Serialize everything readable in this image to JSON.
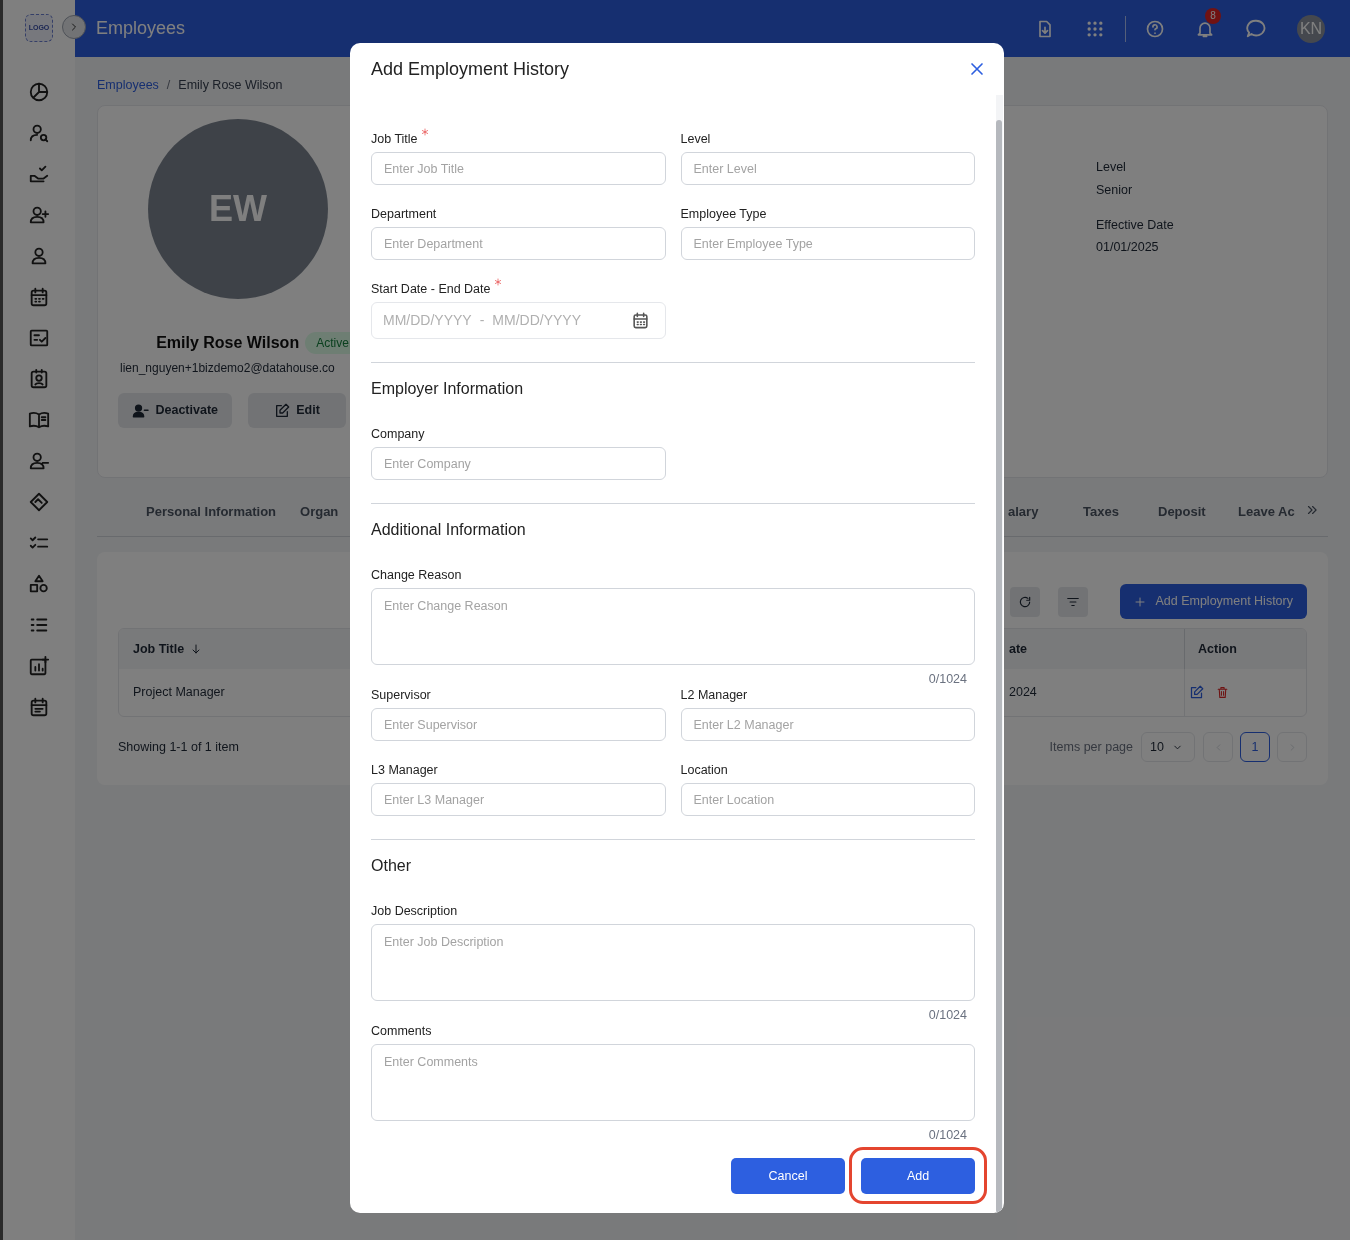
{
  "app_bar": {
    "logo": "LOGO",
    "title": "Employees",
    "notification_count": "8",
    "avatar": "KN"
  },
  "breadcrumb": [
    "Employees",
    "/",
    "Emily Rose Wilson"
  ],
  "profile": {
    "initials": "EW",
    "name": "Emily Rose Wilson",
    "status": "Active",
    "email": "lien_nguyen+1bizdemo2@datahouse.co",
    "buttons": [
      "Deactivate",
      "Edit"
    ],
    "details": [
      {
        "label": "Level",
        "value": "Senior"
      },
      {
        "label": "Effective Date",
        "value": "01/01/2025"
      }
    ]
  },
  "tabs_left": [
    "Personal Information",
    "Organ"
  ],
  "tabs_right": [
    "alary",
    "Taxes",
    "Deposit",
    "Leave Ac"
  ],
  "history": {
    "add_button": "Add Employment History",
    "columns": [
      "Job Title",
      "ate",
      "Action"
    ],
    "rows": [
      [
        "Project Manager",
        "2024"
      ]
    ],
    "showing": "Showing 1-1 of 1 item",
    "per_page_label": "Items per page",
    "page_size": "10",
    "pages": [
      {
        "label": "1",
        "selected": true
      }
    ]
  },
  "dialog": {
    "title": "Add Employment History",
    "sections": [
      {
        "fields": [
          {
            "kind": "input",
            "label": "Job Title",
            "required": true,
            "placeholder": "Enter Job Title"
          },
          {
            "kind": "input",
            "label": "Level",
            "required": false,
            "placeholder": "Enter Level"
          },
          {
            "kind": "input",
            "label": "Department",
            "required": false,
            "placeholder": "Enter Department"
          },
          {
            "kind": "input",
            "label": "Employee Type",
            "required": false,
            "placeholder": "Enter Employee Type"
          },
          {
            "kind": "date_range",
            "label": "Start Date - End Date",
            "required": true,
            "start_placeholder": "MM/DD/YYYY",
            "separator": "-",
            "end_placeholder": "MM/DD/YYYY"
          }
        ]
      },
      {
        "title": "Employer Information",
        "fields": [
          {
            "kind": "input",
            "label": "Company",
            "required": false,
            "placeholder": "Enter Company"
          }
        ]
      },
      {
        "title": "Additional Information",
        "fields": [
          {
            "kind": "textarea",
            "label": "Change Reason",
            "required": false,
            "placeholder": "Enter Change Reason",
            "counter": "0/1024"
          },
          {
            "kind": "input",
            "label": "Supervisor",
            "required": false,
            "placeholder": "Enter Supervisor"
          },
          {
            "kind": "input",
            "label": "L2 Manager",
            "required": false,
            "placeholder": "Enter L2 Manager"
          },
          {
            "kind": "input",
            "label": "L3 Manager",
            "required": false,
            "placeholder": "Enter L3 Manager"
          },
          {
            "kind": "input",
            "label": "Location",
            "required": false,
            "placeholder": "Enter Location"
          }
        ]
      },
      {
        "title": "Other",
        "fields": [
          {
            "kind": "textarea",
            "label": "Job Description",
            "required": false,
            "placeholder": "Enter Job Description",
            "counter": "0/1024"
          },
          {
            "kind": "textarea",
            "label": "Comments",
            "required": false,
            "placeholder": "Enter Comments",
            "counter": "0/1024"
          }
        ]
      }
    ],
    "buttons": [
      {
        "label": "Cancel",
        "highlighted": false
      },
      {
        "label": "Add",
        "highlighted": true
      }
    ]
  }
}
